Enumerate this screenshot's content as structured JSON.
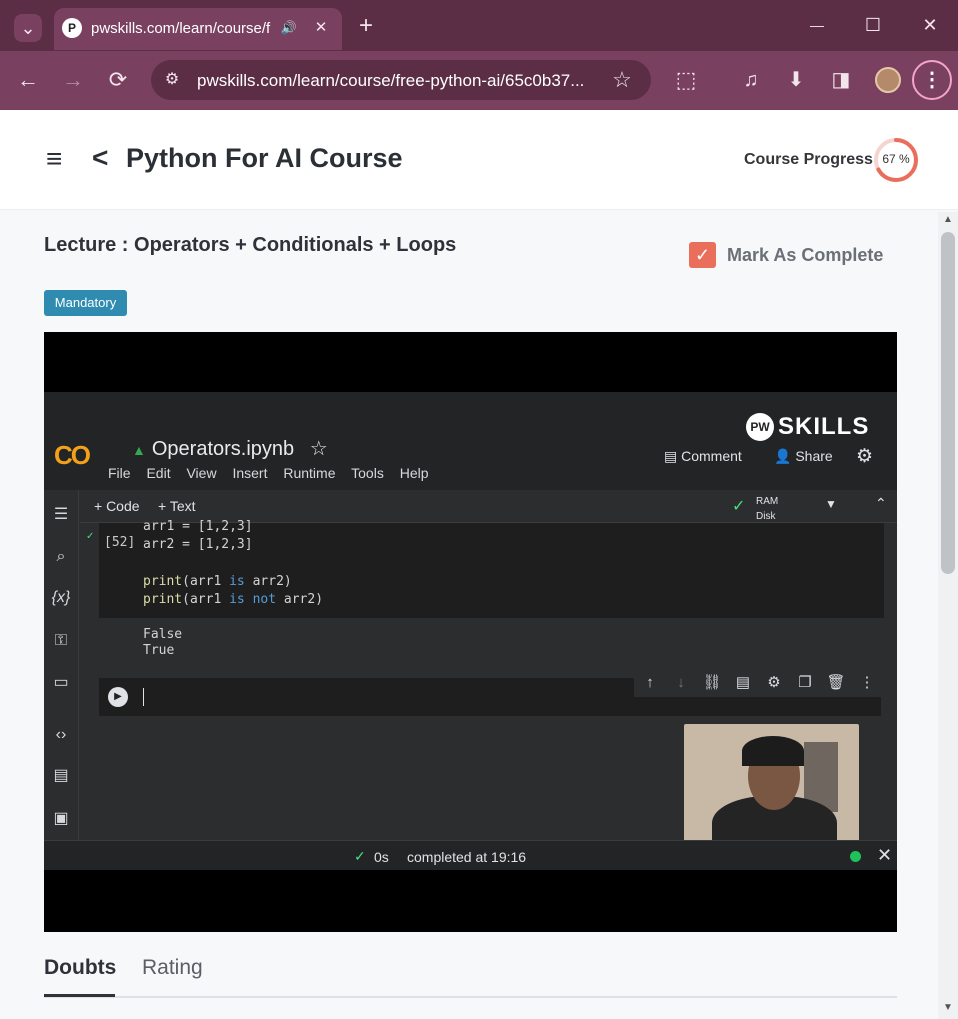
{
  "browser": {
    "tab_title": "pwskills.com/learn/course/fi",
    "url": "pwskills.com/learn/course/free-python-ai/65c0b37...",
    "tab_search_icon": "⌄",
    "new_tab_icon": "+",
    "minimize_icon": "—",
    "maximize_icon": "☐",
    "close_icon": "✕",
    "back_icon": "←",
    "forward_icon": "→",
    "reload_icon": "⟳",
    "site_info_icon": "⚙",
    "star_icon": "☆",
    "extensions_icon": "⬚",
    "media_icon": "♫",
    "download_icon": "⬇",
    "sidepanel_icon": "◨",
    "menu_icon": "⋮",
    "favicon_letter": "P",
    "tab_audio_icon": "🔊",
    "tab_close_icon": "✕"
  },
  "header": {
    "menu_icon": "≡",
    "back_icon": "<",
    "title": "Python For AI Course",
    "progress_label": "Course Progress",
    "progress_text": "67 %",
    "progress_value": 0.67
  },
  "lecture": {
    "title": "Lecture : Operators + Conditionals + Loops",
    "mark_complete_label": "Mark As Complete",
    "mark_complete_check": "✓",
    "badge": "Mandatory"
  },
  "video": {
    "colab_logo": "CO",
    "notebook_name": "Operators.ipynb",
    "notebook_star": "☆",
    "menu": [
      "File",
      "Edit",
      "View",
      "Insert",
      "Runtime",
      "Tools",
      "Help"
    ],
    "pw_circle": "PW",
    "pw_word": "SKILLS",
    "comment": "Comment",
    "share": "Share",
    "add_code": "+ Code",
    "add_text": "+ Text",
    "ram": "RAM",
    "disk": "Disk",
    "cell_number": "[52]",
    "code": {
      "line1": "arr1 = [1,2,3]",
      "line2": "arr2 = [1,2,3]",
      "line3_fn": "print",
      "line3_a": "(arr1 ",
      "line3_kw": "is",
      "line3_b": " arr2)",
      "line4_fn": "print",
      "line4_a": "(arr1 ",
      "line4_kw": "is not",
      "line4_b": " arr2)"
    },
    "output": [
      "False",
      "True"
    ],
    "status_time": "0s",
    "status_completed": "completed at 19:16"
  },
  "tabs": {
    "doubts": "Doubts",
    "rating": "Rating"
  }
}
